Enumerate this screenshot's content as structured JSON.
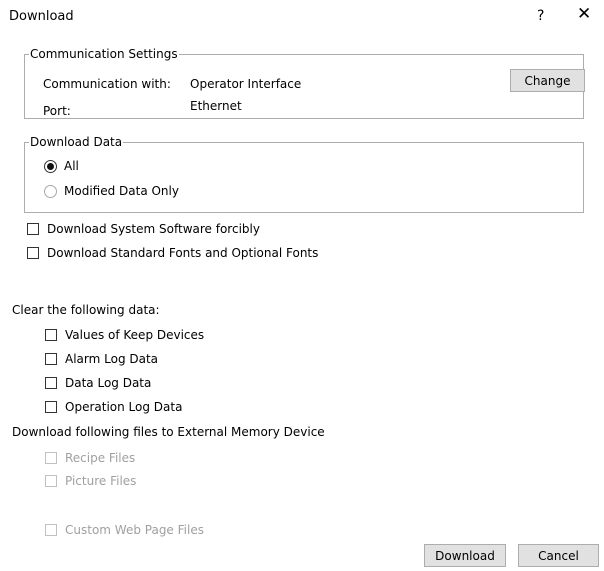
{
  "window": {
    "title": "Download",
    "help": "?",
    "close": "✕"
  },
  "communication": {
    "legend": "Communication Settings",
    "with_label": "Communication with:",
    "with_value": "Operator Interface",
    "port_label": "Port:",
    "port_value": "Ethernet",
    "change_button": "Change"
  },
  "download_data": {
    "legend": "Download Data",
    "options": [
      {
        "label": "All",
        "selected": true
      },
      {
        "label": "Modified Data Only",
        "selected": false
      }
    ]
  },
  "options": {
    "system_software": "Download System Software forcibly",
    "fonts": "Download Standard Fonts and Optional Fonts"
  },
  "clear": {
    "heading": "Clear the following data:",
    "items": [
      "Values of Keep Devices",
      "Alarm Log Data",
      "Data Log Data",
      "Operation Log Data"
    ]
  },
  "external": {
    "heading": "Download following files to External Memory Device",
    "items": [
      "Recipe Files",
      "Picture Files",
      "Custom Web Page Files"
    ]
  },
  "footer": {
    "download_button": "Download",
    "cancel_button": "Cancel"
  },
  "colors": {
    "button_bg": "#e1e1e1",
    "border": "#adadad",
    "disabled_text": "#a0a0a0"
  }
}
